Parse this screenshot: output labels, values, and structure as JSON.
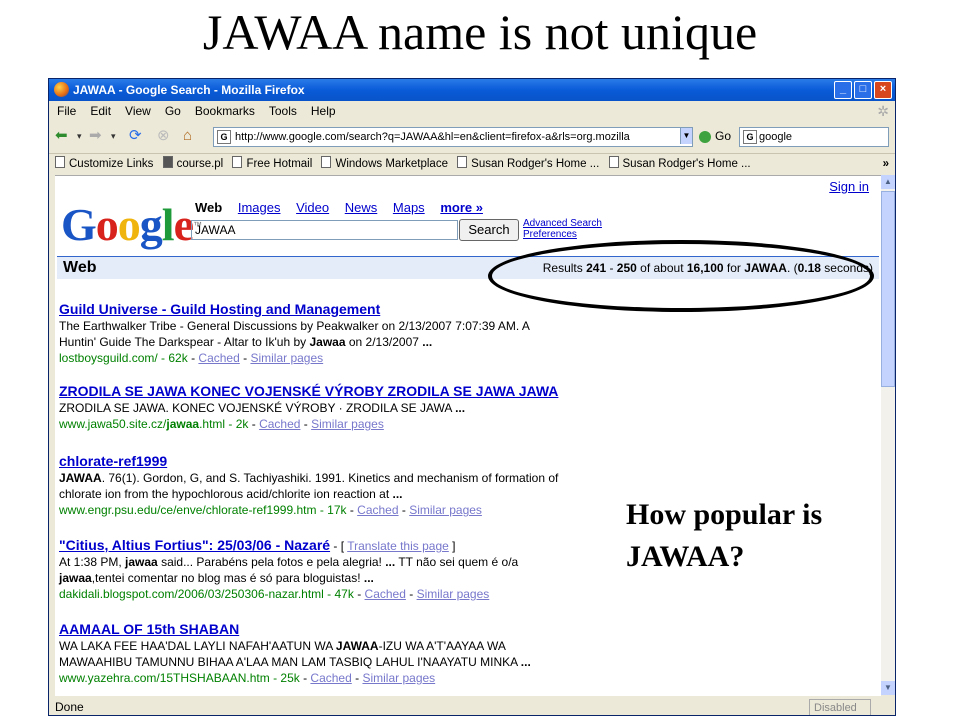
{
  "slide": {
    "title": "JAWAA name is not unique",
    "callout_line1": "How popular is",
    "callout_line2": "JAWAA?"
  },
  "window": {
    "title": "JAWAA - Google Search - Mozilla Firefox",
    "controls": [
      "_",
      "□",
      "×"
    ]
  },
  "menu": [
    "File",
    "Edit",
    "View",
    "Go",
    "Bookmarks",
    "Tools",
    "Help"
  ],
  "nav": {
    "url": "http://www.google.com/search?q=JAWAA&hl=en&client=firefox-a&rls=org.mozilla",
    "go_label": "Go",
    "search_value": "google"
  },
  "bookmarks": [
    "Customize Links",
    "course.pl",
    "Free Hotmail",
    "Windows Marketplace",
    "Susan Rodger's Home ...",
    "Susan Rodger's Home ..."
  ],
  "bookmarks_more": "»",
  "google": {
    "sign_in": "Sign in",
    "logo_letters": [
      "G",
      "o",
      "o",
      "g",
      "l",
      "e"
    ],
    "logo_colors": [
      "#1a55c6",
      "#d8231c",
      "#f0b40e",
      "#1a55c6",
      "#1f9a3a",
      "#d8231c"
    ],
    "tabs": [
      "Web",
      "Images",
      "Video",
      "News",
      "Maps",
      "more »"
    ],
    "query": "JAWAA",
    "search_button": "Search",
    "advanced_search": "Advanced Search",
    "preferences": "Preferences",
    "web_label": "Web",
    "results_summary": {
      "prefix": "Results ",
      "start": "241",
      "dash": " - ",
      "end": "250",
      "mid": " of about ",
      "total": "16,100",
      "for": " for ",
      "term": "JAWAA",
      "paren_open": ". (",
      "time": "0.18",
      "paren_close": " seconds)"
    }
  },
  "results": [
    {
      "title": "Guild Universe - Guild Hosting and Management",
      "snippet1": "The Earthwalker Tribe - General Discussions by Peakwalker on 2/13/2007 7:07:39 AM. A",
      "snippet2a": "Huntin' Guide The Darkspear - Altar to Ik'uh by ",
      "snippet2b": "Jawaa",
      "snippet2c": " on 2/13/2007 ",
      "ellipsis": "...",
      "url": "lostboysguild.com/ - 62k",
      "cached": "Cached",
      "similar": "Similar pages"
    },
    {
      "title": "ZRODILA SE JAWA KONEC VOJENSKÉ VÝROBY ZRODILA SE JAWA JAWA",
      "snippet1": "ZRODILA SE JAWA. KONEC VOJENSKÉ VÝROBY · ZRODILA SE JAWA ",
      "ellipsis": "...",
      "url_a": "www.jawa50.site.cz/",
      "url_b": "jawaa",
      "url_c": ".html - 2k",
      "cached": "Cached",
      "similar": "Similar pages"
    },
    {
      "title": "chlorate-ref1999",
      "snippet1a": "JAWAA",
      "snippet1b": ". 76(1). Gordon, G, and S. Tachiyashiki. 1991. Kinetics and mechanism of formation of",
      "snippet2": "chlorate ion from the hypochlorous acid/chlorite ion reaction at ",
      "ellipsis": "...",
      "url": "www.engr.psu.edu/ce/enve/chlorate-ref1999.htm - 17k",
      "cached": "Cached",
      "similar": "Similar pages"
    },
    {
      "title": "\"Citius, Altius Fortius\": 25/03/06 - Nazaré",
      "translate": "Translate this page",
      "snippet1a": "At 1:38 PM, ",
      "snippet1b": "jawaa",
      "snippet1c": " said... Parabéns pela fotos e pela alegria! ",
      "snippet1d": " TT não sei quem é o/a",
      "snippet2a": "jawaa",
      "snippet2b": ",tentei comentar no blog mas é só para bloguistas! ",
      "ellipsis": "...",
      "url": "dakidali.blogspot.com/2006/03/250306-nazar.html - 47k",
      "cached": "Cached",
      "similar": "Similar pages"
    },
    {
      "title": "AAMAAL OF 15th SHABAN",
      "snippet1a": "WA LAKA FEE HAA'DAL LAYLI NAFAH'AATUN WA ",
      "snippet1b": "JAWAA",
      "snippet1c": "-IZU WA A'T'AAYAA WA",
      "snippet2": "MAWAAHIBU TAMUNNU BIHAA A'LAA MAN LAM TASBIQ LAHUL I'NAAYATU MINKA ",
      "ellipsis": "...",
      "url": "www.yazehra.com/15THSHABAAN.htm - 25k",
      "cached": "Cached",
      "similar": "Similar pages"
    }
  ],
  "status": {
    "text": "Done",
    "right": "Disabled"
  }
}
